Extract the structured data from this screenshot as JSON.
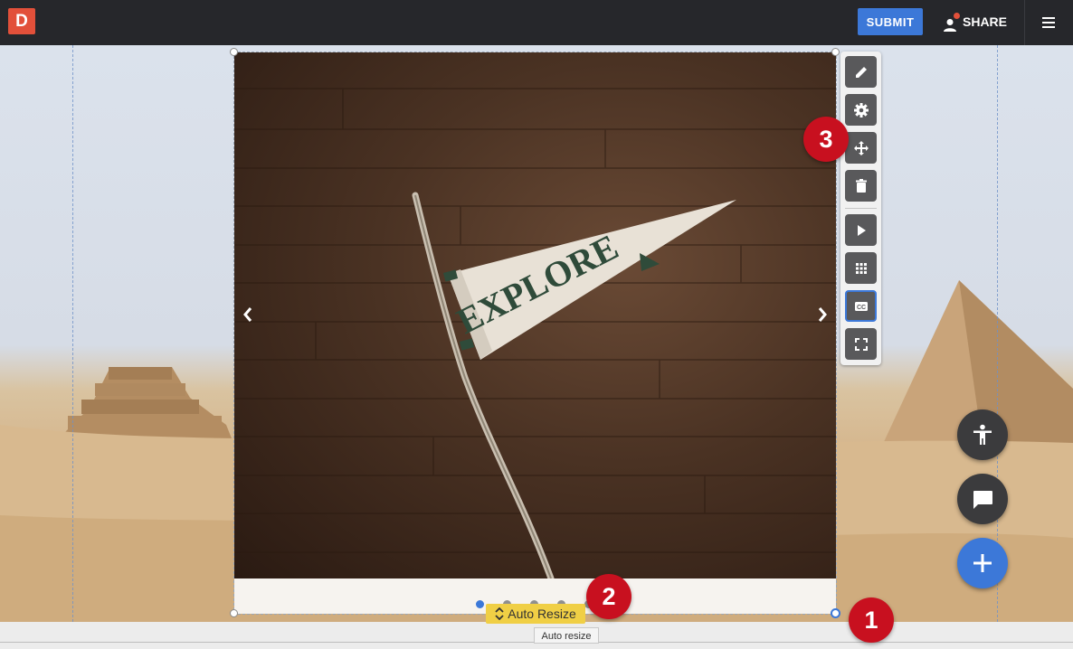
{
  "topbar": {
    "logo_letter": "D",
    "submit_label": "SUBMIT",
    "share_label": "SHARE"
  },
  "slideshow": {
    "pennant_text": "EXPLORE",
    "slide_count": 5,
    "active_slide": 1
  },
  "auto_resize": {
    "label": "Auto Resize",
    "tooltip": "Auto resize"
  },
  "toolbar": {
    "buttons": [
      {
        "icon": "pencil-icon"
      },
      {
        "icon": "gear-icon"
      },
      {
        "icon": "move-icon"
      },
      {
        "icon": "trash-icon"
      },
      {
        "icon": "play-icon"
      },
      {
        "icon": "grid-icon"
      },
      {
        "icon": "closed-captions-icon",
        "selected": true
      },
      {
        "icon": "fullscreen-icon"
      }
    ]
  },
  "badges": [
    "1",
    "2",
    "3"
  ],
  "fabs": [
    {
      "icon": "accessibility-icon"
    },
    {
      "icon": "chat-icon"
    },
    {
      "icon": "plus-icon"
    }
  ],
  "colors": {
    "accent_blue": "#3c78d8",
    "logo_red": "#e2503a",
    "badge_red": "#c8101f",
    "topbar": "#26272b",
    "auto_resize_yellow": "#f0cf45"
  }
}
